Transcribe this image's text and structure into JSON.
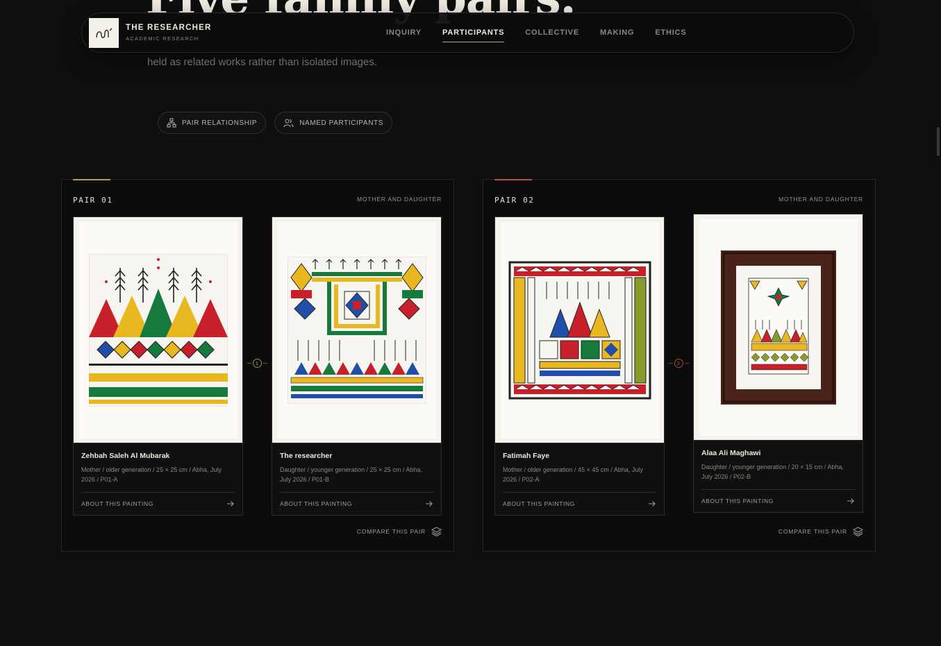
{
  "hero": {
    "title": "Five family pairs.",
    "subtitle": "held as related works rather than isolated images."
  },
  "nav": {
    "brand": "THE RESEARCHER",
    "brand_sub": "ACADEMIC RESEARCH",
    "links": [
      "INQUIRY",
      "PARTICIPANTS",
      "COLLECTIVE",
      "MAKING",
      "ETHICS"
    ],
    "active": "PARTICIPANTS"
  },
  "chips": [
    {
      "label": "PAIR RELATIONSHIP",
      "icon": "hierarchy-icon"
    },
    {
      "label": "NAMED PARTICIPANTS",
      "icon": "users-icon"
    }
  ],
  "pairs": [
    {
      "label": "PAIR 01",
      "relationship": "MOTHER AND DAUGHTER",
      "accent": "#b49a5e",
      "connector": "1",
      "compare": "COMPARE THIS PAIR",
      "works": [
        {
          "name": "Zehbah Saleh Al Mubarak",
          "meta": "Mother / older generation / 25 × 25 cm / Abha, July 2026 / P01-A",
          "about": "ABOUT THIS PAINTING"
        },
        {
          "name": "The researcher",
          "meta": "Daughter / younger generation / 25 × 25 cm / Abha, July 2026 / P01-B",
          "about": "ABOUT THIS PAINTING"
        }
      ]
    },
    {
      "label": "PAIR 02",
      "relationship": "MOTHER AND DAUGHTER",
      "accent": "#b4533f",
      "connector": "2",
      "compare": "COMPARE THIS PAIR",
      "works": [
        {
          "name": "Fatimah Faye",
          "meta": "Mother / older generation / 45 × 45 cm / Abha, July 2026 / P02-A",
          "about": "ABOUT THIS PAINTING"
        },
        {
          "name": "Alaa Ali Maghawi",
          "meta": "Daughter / younger generation / 20 × 15 cm / Abha, July 2026 / P02-B",
          "about": "ABOUT THIS PAINTING"
        }
      ]
    }
  ],
  "colors": {
    "background": "#0f0f0f",
    "gold": "#b49a5e",
    "red": "#c8202b",
    "green": "#157a3c",
    "yellow": "#e9b820",
    "blue": "#1f4fa8"
  }
}
